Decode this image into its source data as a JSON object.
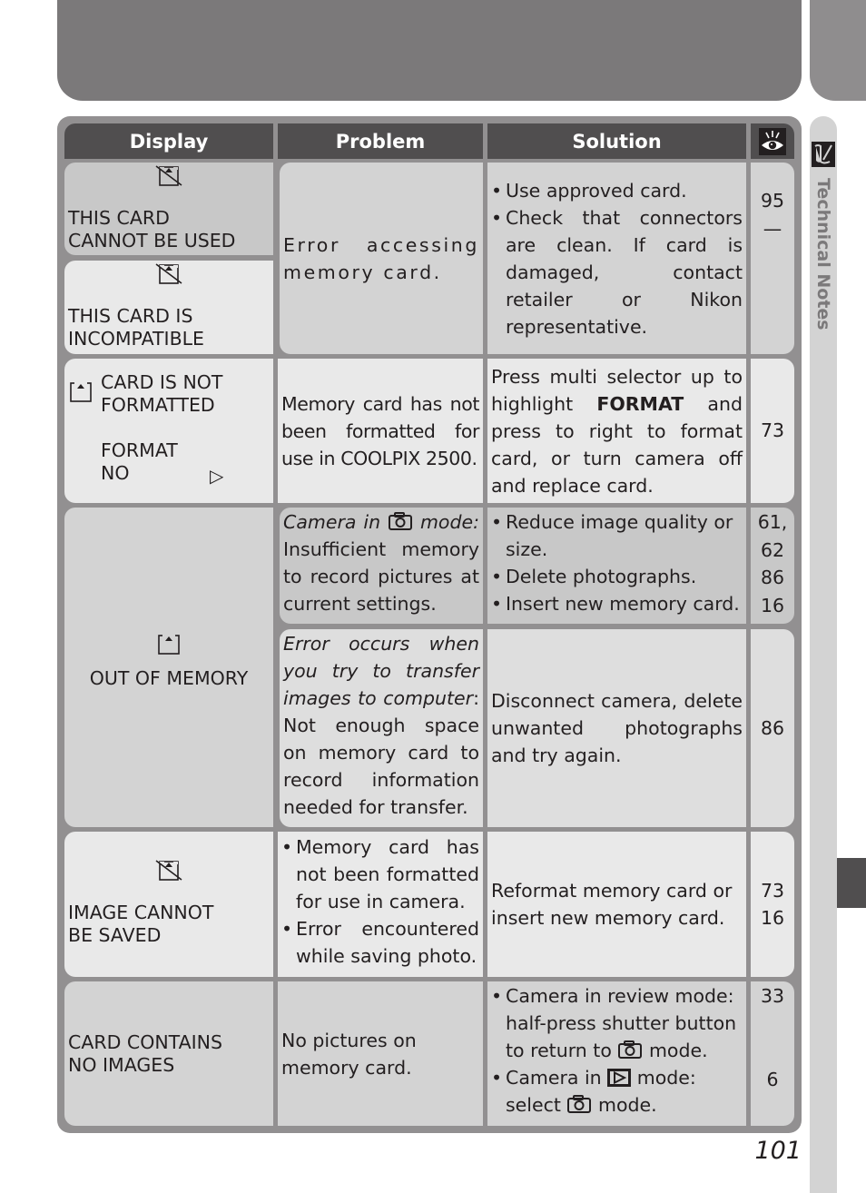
{
  "page": {
    "section_title": "Technical Notes",
    "page_number": "101",
    "section_icon": "pencil-note-icon",
    "colors": {
      "header_bg": "#504e4f",
      "frame": "#929091",
      "top_block": "#7b797a",
      "sidebar": "#d3d3d3"
    }
  },
  "table": {
    "headers": {
      "display": "Display",
      "problem": "Problem",
      "solution": "Solution",
      "page_icon": "eye-icon"
    },
    "rows": [
      {
        "display": [
          {
            "icon": "card-error-icon",
            "text": [
              "THIS CARD",
              "CANNOT BE USED"
            ]
          },
          {
            "icon": "card-error-icon",
            "text": [
              "THIS CARD IS",
              "INCOMPATIBLE"
            ]
          }
        ],
        "problem": "Error accessing memory card.",
        "solution": [
          {
            "text": "Use approved card.",
            "page": "95"
          },
          {
            "text": "Check that connectors are clean.  If card is damaged, contact retailer or Nikon representative.",
            "page": "—"
          }
        ]
      },
      {
        "display": {
          "icon": "card-icon",
          "text": [
            "CARD IS NOT",
            "FORMATTED"
          ],
          "menu": [
            "FORMAT",
            "NO"
          ],
          "menu_arrow": "▷"
        },
        "problem": "Memory card has not been formatted for use in COOLPIX 2500.",
        "solution": {
          "pre": "Press multi selector up to highlight",
          "bold": "FORMAT",
          "post": "and press to right to format card, or turn camera off and replace card."
        },
        "pages": [
          "73"
        ]
      },
      {
        "display": {
          "icon": "card-icon",
          "text": "OUT OF MEMORY"
        },
        "sub": [
          {
            "problem": {
              "italic_pre": "Camera in",
              "icon": "camera-icon",
              "italic_post": "mode:",
              "text": "Insufficient memory to record pictures at current settings."
            },
            "solution": [
              "Reduce image quality or size.",
              "Delete photographs.",
              "Insert new memory card."
            ],
            "pages": [
              "61,",
              "62",
              "86",
              "16"
            ]
          },
          {
            "problem": {
              "italic": "Error occurs when you try to transfer images to computer",
              "text": "Not enough space on memory card to record information needed for transfer."
            },
            "solution": "Disconnect camera, delete unwanted photographs and try again.",
            "pages": [
              "86"
            ]
          }
        ]
      },
      {
        "display": {
          "icon": "card-error-icon",
          "text": [
            "IMAGE CANNOT",
            "BE SAVED"
          ]
        },
        "problem": [
          "Memory card has not been formatted for use in camera.",
          "Error encountered while saving photo."
        ],
        "solution": "Reformat memory card or insert new memory card.",
        "pages": [
          "73",
          "16"
        ]
      },
      {
        "display": {
          "text": [
            "CARD CONTAINS",
            "NO IMAGES"
          ]
        },
        "problem": "No pictures on memory card.",
        "solution": [
          {
            "pre": "Camera in review mode: half-press shutter button to return to",
            "icon": "camera-icon",
            "post": "mode.",
            "page": "33"
          },
          {
            "pre": "Camera in",
            "icon": "playback-icon",
            "mid": "mode: select",
            "icon2": "camera-icon",
            "post": "mode.",
            "page": "6"
          }
        ]
      }
    ]
  }
}
